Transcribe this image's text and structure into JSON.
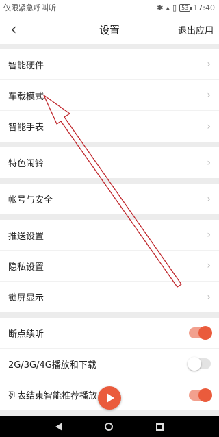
{
  "status_bar": {
    "carrier": "仅限紧急呼叫听",
    "battery": "53",
    "time": "17:40"
  },
  "header": {
    "title": "设置",
    "back_glyph": "‹",
    "exit_label": "退出应用"
  },
  "groups": [
    {
      "items": [
        {
          "label": "智能硬件",
          "type": "nav"
        },
        {
          "label": "车载模式",
          "type": "nav"
        },
        {
          "label": "智能手表",
          "type": "nav"
        }
      ]
    },
    {
      "items": [
        {
          "label": "特色闹铃",
          "type": "nav"
        }
      ]
    },
    {
      "items": [
        {
          "label": "帐号与安全",
          "type": "nav"
        }
      ]
    },
    {
      "items": [
        {
          "label": "推送设置",
          "type": "nav"
        },
        {
          "label": "隐私设置",
          "type": "nav"
        },
        {
          "label": "锁屏显示",
          "type": "nav"
        }
      ]
    },
    {
      "items": [
        {
          "label": "断点续听",
          "type": "toggle",
          "on": true
        },
        {
          "label": "2G/3G/4G播放和下载",
          "type": "toggle",
          "on": false
        },
        {
          "label": "列表结束智能推荐播放",
          "type": "toggle",
          "on": true
        }
      ]
    }
  ],
  "chevron_glyph": "›",
  "colors": {
    "accent": "#ea5b3c",
    "annotation_arrow": "#c0282d"
  }
}
